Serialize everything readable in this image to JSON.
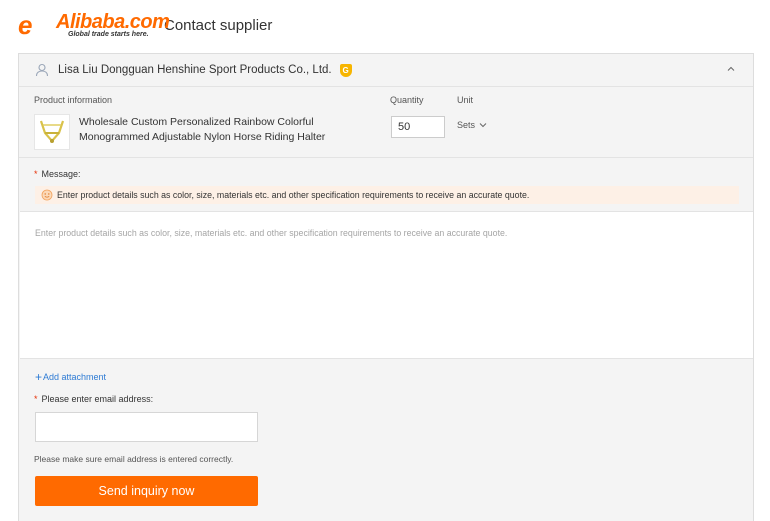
{
  "header": {
    "logo_mark": "e",
    "logo_name": "Alibaba.com",
    "logo_tagline": "Global trade starts here.",
    "page_title": "Contact supplier"
  },
  "supplier": {
    "name": "Lisa Liu Dongguan Henshine Sport Products Co., Ltd.",
    "badge": "G"
  },
  "product": {
    "section_label": "Product information",
    "quantity_label": "Quantity",
    "unit_label": "Unit",
    "name": "Wholesale Custom Personalized Rainbow Colorful Monogrammed Adjustable Nylon Horse Riding Halter",
    "quantity": "50",
    "unit": "Sets"
  },
  "message": {
    "required_mark": "*",
    "label": "Message:",
    "tip": "Enter product details such as color, size, materials etc. and other specification requirements to receive an accurate quote.",
    "placeholder": "Enter product details such as color, size, materials etc. and other specification requirements to receive an accurate quote."
  },
  "attachment": {
    "icon": "+",
    "label": "Add attachment"
  },
  "email": {
    "required_mark": "*",
    "label": "Please enter email address:",
    "value": "",
    "hint": "Please make sure email address is entered correctly."
  },
  "submit": {
    "label": "Send inquiry now"
  },
  "colors": {
    "brand": "#ff6a00",
    "link": "#2e7bd4",
    "tip_bg": "#fdf0e6",
    "required": "#e62e04"
  },
  "icons": {
    "user": "user-icon",
    "gold_supplier": "gold-supplier-badge",
    "collapse": "chevron-up-icon",
    "smile": "smile-icon",
    "unit_dropdown": "chevron-down-icon"
  }
}
